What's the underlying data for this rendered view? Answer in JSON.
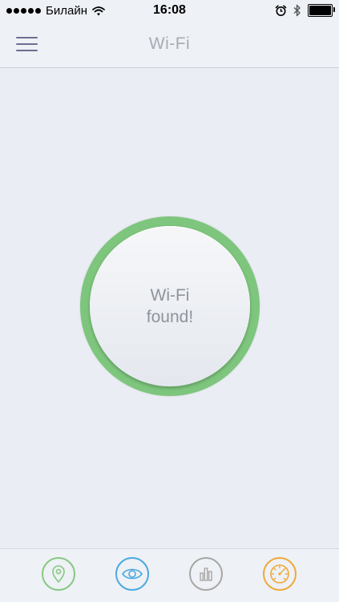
{
  "status_bar": {
    "carrier": "Билайн",
    "time": "16:08"
  },
  "nav": {
    "title": "Wi-Fi",
    "menu_icon": "hamburger-menu-icon"
  },
  "main": {
    "status_line1": "Wi-Fi",
    "status_line2": "found!",
    "ring_color": "#7ec67d"
  },
  "tabs": [
    {
      "icon": "location-pin-icon",
      "color": "#86c882"
    },
    {
      "icon": "eye-icon",
      "color": "#4aa8e0"
    },
    {
      "icon": "bar-chart-icon",
      "color": "#a8a6a4"
    },
    {
      "icon": "speedometer-icon",
      "color": "#efa83a"
    }
  ]
}
